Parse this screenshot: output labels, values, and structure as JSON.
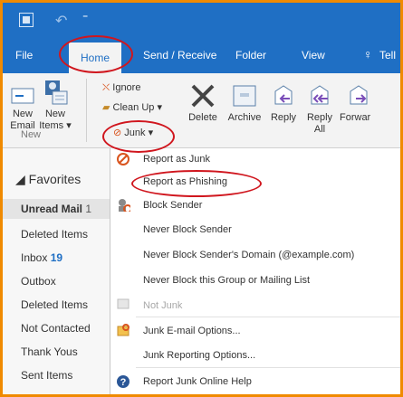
{
  "titlebar": {
    "app_icon": "outlook-icon",
    "undo": "↶",
    "quick_access_more": "⁼"
  },
  "tabs": [
    "File",
    "Home",
    "Send / Receive",
    "Folder",
    "View",
    "Tell"
  ],
  "ribbon": {
    "new_email": [
      "New",
      "Email"
    ],
    "new_items": [
      "New",
      "Items"
    ],
    "new_items_caret": "▾",
    "group_new": "New",
    "ignore": "Ignore",
    "clean_up": "Clean Up",
    "clean_up_caret": "▾",
    "junk": "Junk",
    "junk_caret": "▾",
    "delete": "Delete",
    "archive": "Archive",
    "reply": "Reply",
    "reply_all": [
      "Reply",
      "All"
    ],
    "forward": "Forwar"
  },
  "nav": {
    "favorites": "◢ Favorites",
    "items": [
      {
        "label": "Unread Mail",
        "count": ""
      },
      {
        "label": "Deleted Items",
        "count": ""
      },
      {
        "label": "Inbox",
        "count": "19"
      },
      {
        "label": "Outbox",
        "count": ""
      },
      {
        "label": "Deleted Items",
        "count": ""
      },
      {
        "label": "Not Contacted",
        "count": ""
      },
      {
        "label": "Thank Yous",
        "count": ""
      },
      {
        "label": "Sent Items",
        "count": ""
      }
    ],
    "selected_marker": "1"
  },
  "junk_menu": {
    "items": [
      {
        "label": "Report as Junk",
        "disabled": false,
        "icon": "junk-report-icon"
      },
      {
        "label": "Report as Phishing",
        "disabled": false,
        "icon": ""
      },
      {
        "label": "Block Sender",
        "disabled": false,
        "icon": "block-sender-icon"
      },
      {
        "label": "Never Block Sender",
        "disabled": false,
        "icon": ""
      },
      {
        "label": "Never Block Sender's Domain (@example.com)",
        "disabled": false,
        "icon": ""
      },
      {
        "label": "Never Block this Group or Mailing List",
        "disabled": false,
        "icon": ""
      },
      {
        "label": "Not Junk",
        "disabled": true,
        "icon": "not-junk-icon"
      },
      {
        "label": "Junk E-mail Options...",
        "disabled": false,
        "icon": "junk-options-icon"
      },
      {
        "label": "Junk Reporting Options...",
        "disabled": false,
        "icon": ""
      },
      {
        "label": "Report Junk Online Help",
        "disabled": false,
        "icon": "help-icon"
      }
    ]
  },
  "colors": {
    "accent": "#1f6fc4",
    "highlight_oval": "#d0161e",
    "frame_border": "#f08a00"
  }
}
